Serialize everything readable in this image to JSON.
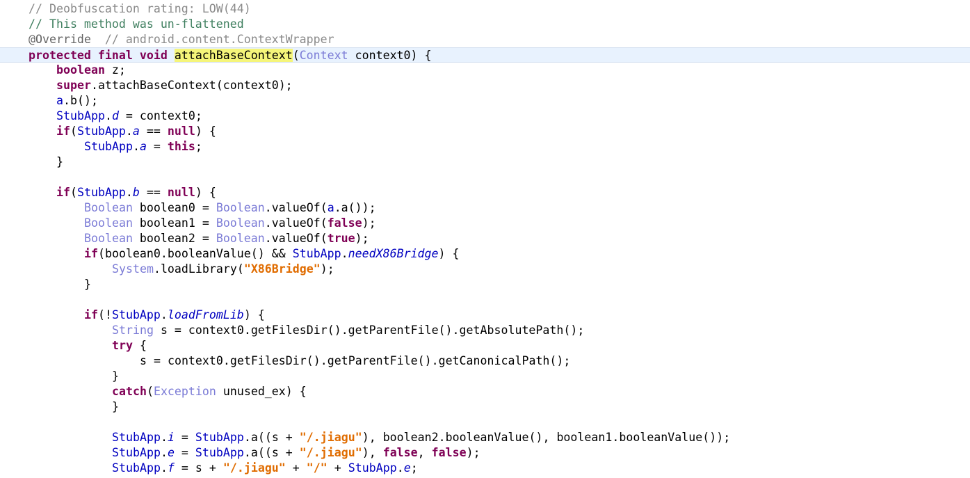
{
  "editor": {
    "lines": [
      {
        "indent": 0,
        "current": false,
        "tokens": [
          {
            "t": "// Deobfuscation rating: LOW(44)",
            "k": "faded"
          }
        ]
      },
      {
        "indent": 0,
        "current": false,
        "tokens": [
          {
            "t": "// This method was un-flattened",
            "k": "comment"
          }
        ]
      },
      {
        "indent": 0,
        "current": false,
        "tokens": [
          {
            "t": "@Override",
            "k": "annot"
          },
          {
            "t": "  // android.content.ContextWrapper",
            "k": "faded"
          }
        ]
      },
      {
        "indent": 0,
        "current": true,
        "tokens": [
          {
            "t": "protected",
            "k": "kw"
          },
          {
            "t": " ",
            "k": "plain"
          },
          {
            "t": "final",
            "k": "kw"
          },
          {
            "t": " ",
            "k": "plain"
          },
          {
            "t": "void",
            "k": "kw"
          },
          {
            "t": " ",
            "k": "plain"
          },
          {
            "t": "attachBaseContext",
            "k": "hl"
          },
          {
            "t": "(",
            "k": "plain"
          },
          {
            "t": "Context",
            "k": "type"
          },
          {
            "t": " context0) {",
            "k": "plain"
          }
        ]
      },
      {
        "indent": 1,
        "current": false,
        "tokens": [
          {
            "t": "boolean",
            "k": "kw"
          },
          {
            "t": " z;",
            "k": "plain"
          }
        ]
      },
      {
        "indent": 1,
        "current": false,
        "tokens": [
          {
            "t": "super",
            "k": "kw"
          },
          {
            "t": ".attachBaseContext(context0);",
            "k": "plain"
          }
        ]
      },
      {
        "indent": 1,
        "current": false,
        "tokens": [
          {
            "t": "a",
            "k": "class"
          },
          {
            "t": ".b();",
            "k": "plain"
          }
        ]
      },
      {
        "indent": 1,
        "current": false,
        "tokens": [
          {
            "t": "StubApp",
            "k": "class"
          },
          {
            "t": ".",
            "k": "plain"
          },
          {
            "t": "d",
            "k": "static"
          },
          {
            "t": " = context0;",
            "k": "plain"
          }
        ]
      },
      {
        "indent": 1,
        "current": false,
        "tokens": [
          {
            "t": "if",
            "k": "kw"
          },
          {
            "t": "(",
            "k": "plain"
          },
          {
            "t": "StubApp",
            "k": "class"
          },
          {
            "t": ".",
            "k": "plain"
          },
          {
            "t": "a",
            "k": "static"
          },
          {
            "t": " == ",
            "k": "plain"
          },
          {
            "t": "null",
            "k": "kw"
          },
          {
            "t": ") {",
            "k": "plain"
          }
        ]
      },
      {
        "indent": 2,
        "current": false,
        "tokens": [
          {
            "t": "StubApp",
            "k": "class"
          },
          {
            "t": ".",
            "k": "plain"
          },
          {
            "t": "a",
            "k": "static"
          },
          {
            "t": " = ",
            "k": "plain"
          },
          {
            "t": "this",
            "k": "kw"
          },
          {
            "t": ";",
            "k": "plain"
          }
        ]
      },
      {
        "indent": 1,
        "current": false,
        "tokens": [
          {
            "t": "}",
            "k": "plain"
          }
        ]
      },
      {
        "indent": 0,
        "current": false,
        "tokens": []
      },
      {
        "indent": 1,
        "current": false,
        "tokens": [
          {
            "t": "if",
            "k": "kw"
          },
          {
            "t": "(",
            "k": "plain"
          },
          {
            "t": "StubApp",
            "k": "class"
          },
          {
            "t": ".",
            "k": "plain"
          },
          {
            "t": "b",
            "k": "static"
          },
          {
            "t": " == ",
            "k": "plain"
          },
          {
            "t": "null",
            "k": "kw"
          },
          {
            "t": ") {",
            "k": "plain"
          }
        ]
      },
      {
        "indent": 2,
        "current": false,
        "tokens": [
          {
            "t": "Boolean",
            "k": "type"
          },
          {
            "t": " boolean0 = ",
            "k": "plain"
          },
          {
            "t": "Boolean",
            "k": "type"
          },
          {
            "t": ".valueOf(",
            "k": "plain"
          },
          {
            "t": "a",
            "k": "class"
          },
          {
            "t": ".a());",
            "k": "plain"
          }
        ]
      },
      {
        "indent": 2,
        "current": false,
        "tokens": [
          {
            "t": "Boolean",
            "k": "type"
          },
          {
            "t": " boolean1 = ",
            "k": "plain"
          },
          {
            "t": "Boolean",
            "k": "type"
          },
          {
            "t": ".valueOf(",
            "k": "plain"
          },
          {
            "t": "false",
            "k": "kw"
          },
          {
            "t": ");",
            "k": "plain"
          }
        ]
      },
      {
        "indent": 2,
        "current": false,
        "tokens": [
          {
            "t": "Boolean",
            "k": "type"
          },
          {
            "t": " boolean2 = ",
            "k": "plain"
          },
          {
            "t": "Boolean",
            "k": "type"
          },
          {
            "t": ".valueOf(",
            "k": "plain"
          },
          {
            "t": "true",
            "k": "kw"
          },
          {
            "t": ");",
            "k": "plain"
          }
        ]
      },
      {
        "indent": 2,
        "current": false,
        "tokens": [
          {
            "t": "if",
            "k": "kw"
          },
          {
            "t": "(boolean0.booleanValue() && ",
            "k": "plain"
          },
          {
            "t": "StubApp",
            "k": "class"
          },
          {
            "t": ".",
            "k": "plain"
          },
          {
            "t": "needX86Bridge",
            "k": "static"
          },
          {
            "t": ") {",
            "k": "plain"
          }
        ]
      },
      {
        "indent": 3,
        "current": false,
        "tokens": [
          {
            "t": "System",
            "k": "type"
          },
          {
            "t": ".loadLibrary(",
            "k": "plain"
          },
          {
            "t": "\"X86Bridge\"",
            "k": "str"
          },
          {
            "t": ");",
            "k": "plain"
          }
        ]
      },
      {
        "indent": 2,
        "current": false,
        "tokens": [
          {
            "t": "}",
            "k": "plain"
          }
        ]
      },
      {
        "indent": 0,
        "current": false,
        "tokens": []
      },
      {
        "indent": 2,
        "current": false,
        "tokens": [
          {
            "t": "if",
            "k": "kw"
          },
          {
            "t": "(!",
            "k": "plain"
          },
          {
            "t": "StubApp",
            "k": "class"
          },
          {
            "t": ".",
            "k": "plain"
          },
          {
            "t": "loadFromLib",
            "k": "static"
          },
          {
            "t": ") {",
            "k": "plain"
          }
        ]
      },
      {
        "indent": 3,
        "current": false,
        "tokens": [
          {
            "t": "String",
            "k": "type"
          },
          {
            "t": " s = context0.getFilesDir().getParentFile().getAbsolutePath();",
            "k": "plain"
          }
        ]
      },
      {
        "indent": 3,
        "current": false,
        "tokens": [
          {
            "t": "try",
            "k": "kw"
          },
          {
            "t": " {",
            "k": "plain"
          }
        ]
      },
      {
        "indent": 4,
        "current": false,
        "tokens": [
          {
            "t": "s = context0.getFilesDir().getParentFile().getCanonicalPath();",
            "k": "plain"
          }
        ]
      },
      {
        "indent": 3,
        "current": false,
        "tokens": [
          {
            "t": "}",
            "k": "plain"
          }
        ]
      },
      {
        "indent": 3,
        "current": false,
        "tokens": [
          {
            "t": "catch",
            "k": "kw"
          },
          {
            "t": "(",
            "k": "plain"
          },
          {
            "t": "Exception",
            "k": "type"
          },
          {
            "t": " unused_ex) {",
            "k": "plain"
          }
        ]
      },
      {
        "indent": 3,
        "current": false,
        "tokens": [
          {
            "t": "}",
            "k": "plain"
          }
        ]
      },
      {
        "indent": 0,
        "current": false,
        "tokens": []
      },
      {
        "indent": 3,
        "current": false,
        "tokens": [
          {
            "t": "StubApp",
            "k": "class"
          },
          {
            "t": ".",
            "k": "plain"
          },
          {
            "t": "i",
            "k": "static"
          },
          {
            "t": " = ",
            "k": "plain"
          },
          {
            "t": "StubApp",
            "k": "class"
          },
          {
            "t": ".a((s + ",
            "k": "plain"
          },
          {
            "t": "\"/.jiagu\"",
            "k": "str"
          },
          {
            "t": "), boolean2.booleanValue(), boolean1.booleanValue());",
            "k": "plain"
          }
        ]
      },
      {
        "indent": 3,
        "current": false,
        "tokens": [
          {
            "t": "StubApp",
            "k": "class"
          },
          {
            "t": ".",
            "k": "plain"
          },
          {
            "t": "e",
            "k": "static"
          },
          {
            "t": " = ",
            "k": "plain"
          },
          {
            "t": "StubApp",
            "k": "class"
          },
          {
            "t": ".a((s + ",
            "k": "plain"
          },
          {
            "t": "\"/.jiagu\"",
            "k": "str"
          },
          {
            "t": "), ",
            "k": "plain"
          },
          {
            "t": "false",
            "k": "kw"
          },
          {
            "t": ", ",
            "k": "plain"
          },
          {
            "t": "false",
            "k": "kw"
          },
          {
            "t": ");",
            "k": "plain"
          }
        ]
      },
      {
        "indent": 3,
        "current": false,
        "tokens": [
          {
            "t": "StubApp",
            "k": "class"
          },
          {
            "t": ".",
            "k": "plain"
          },
          {
            "t": "f",
            "k": "static"
          },
          {
            "t": " = s + ",
            "k": "plain"
          },
          {
            "t": "\"/.jiagu\"",
            "k": "str"
          },
          {
            "t": " + ",
            "k": "plain"
          },
          {
            "t": "\"/\"",
            "k": "str"
          },
          {
            "t": " + ",
            "k": "plain"
          },
          {
            "t": "StubApp",
            "k": "class"
          },
          {
            "t": ".",
            "k": "plain"
          },
          {
            "t": "e",
            "k": "static"
          },
          {
            "t": ";",
            "k": "plain"
          }
        ]
      }
    ]
  }
}
